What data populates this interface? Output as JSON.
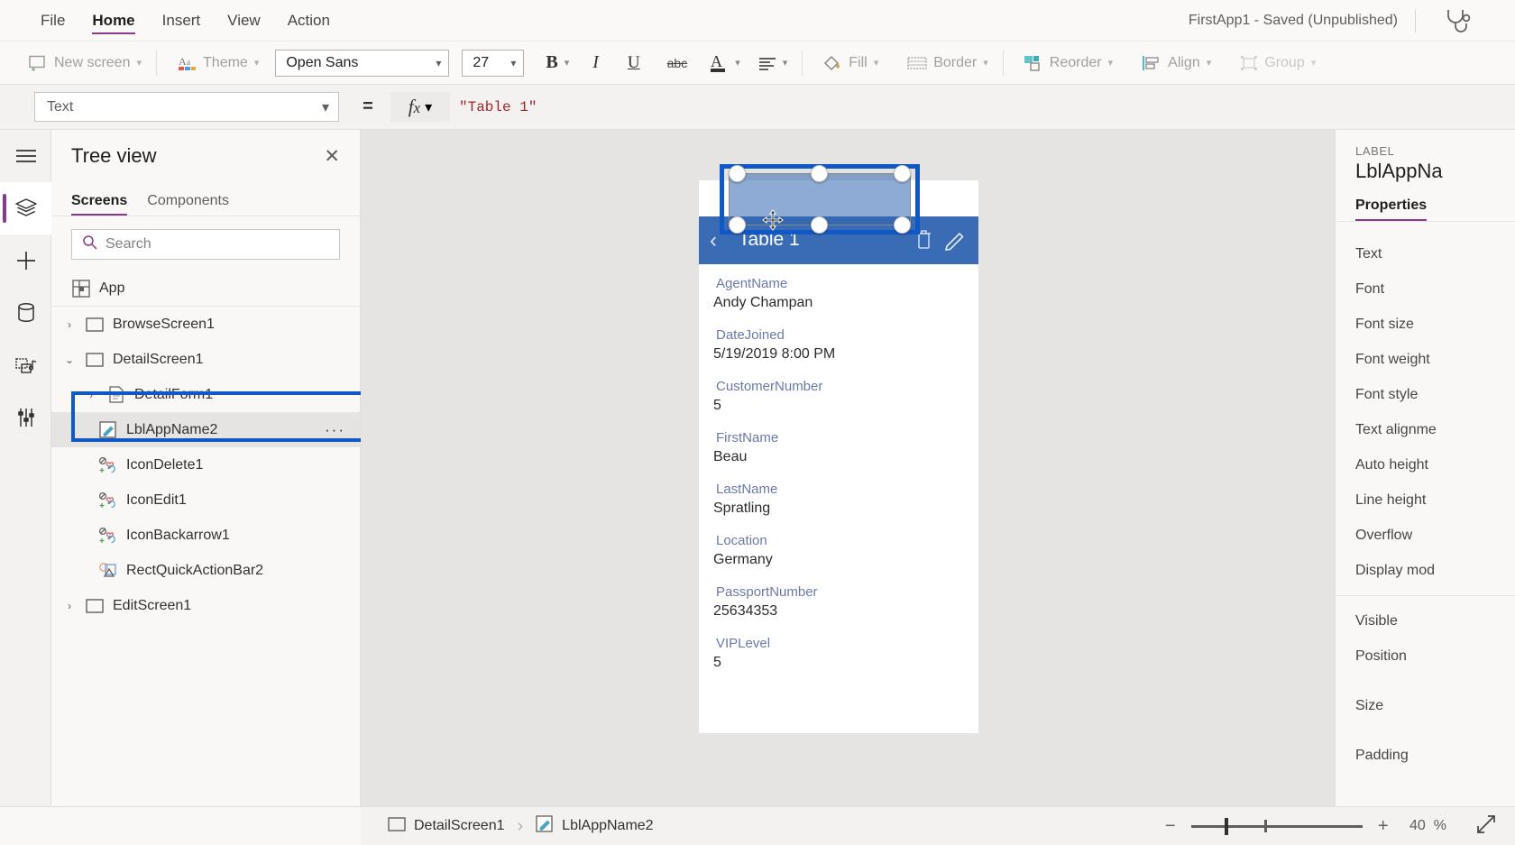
{
  "menubar": {
    "items": [
      {
        "label": "File",
        "active": false
      },
      {
        "label": "Home",
        "active": true
      },
      {
        "label": "Insert",
        "active": false
      },
      {
        "label": "View",
        "active": false
      },
      {
        "label": "Action",
        "active": false
      }
    ],
    "app_status": "FirstApp1 - Saved (Unpublished)",
    "checker_icon": "stethoscope-icon"
  },
  "ribbon": {
    "new_screen": "New screen",
    "theme": "Theme",
    "font_family": "Open Sans",
    "font_size": "27",
    "bold": "B",
    "italic": "I",
    "underline": "U",
    "strikethrough": "abc",
    "font_color": "A",
    "align": "align-icon",
    "fill": "Fill",
    "border": "Border",
    "reorder": "Reorder",
    "align_label": "Align",
    "group": "Group"
  },
  "formula_bar": {
    "property": "Text",
    "equals": "=",
    "fx": "fx",
    "value": "\"Table 1\""
  },
  "rail": {
    "items": [
      {
        "name": "hamburger-icon",
        "active": false
      },
      {
        "name": "tree-view-icon",
        "active": true
      },
      {
        "name": "insert-icon",
        "active": false
      },
      {
        "name": "data-icon",
        "active": false
      },
      {
        "name": "media-icon",
        "active": false
      },
      {
        "name": "variables-icon",
        "active": false
      }
    ]
  },
  "treeview": {
    "title": "Tree view",
    "close": "✕",
    "tabs": [
      {
        "label": "Screens",
        "active": true
      },
      {
        "label": "Components",
        "active": false
      }
    ],
    "search_placeholder": "Search",
    "search_value": "",
    "nodes": [
      {
        "label": "App",
        "icon": "app-icon",
        "caret": "",
        "indent": 0,
        "selected": false
      },
      {
        "label": "BrowseScreen1",
        "icon": "screen-icon",
        "caret": "›",
        "indent": 0,
        "selected": false
      },
      {
        "label": "DetailScreen1",
        "icon": "screen-icon",
        "caret": "⌄",
        "indent": 0,
        "selected": false
      },
      {
        "label": "DetailForm1",
        "icon": "form-icon",
        "caret": "›",
        "indent": 1,
        "selected": false
      },
      {
        "label": "LblAppName2",
        "icon": "label-icon",
        "caret": "",
        "indent": 1,
        "selected": true,
        "overflow": "···"
      },
      {
        "label": "IconDelete1",
        "icon": "icon-control-icon",
        "caret": "",
        "indent": 1,
        "selected": false
      },
      {
        "label": "IconEdit1",
        "icon": "icon-control-icon",
        "caret": "",
        "indent": 1,
        "selected": false
      },
      {
        "label": "IconBackarrow1",
        "icon": "icon-control-icon",
        "caret": "",
        "indent": 1,
        "selected": false
      },
      {
        "label": "RectQuickActionBar2",
        "icon": "shape-icon",
        "caret": "",
        "indent": 1,
        "selected": false
      },
      {
        "label": "EditScreen1",
        "icon": "screen-icon",
        "caret": "›",
        "indent": 0,
        "selected": false
      }
    ]
  },
  "canvas": {
    "quick_action_bar": {
      "back_icon": "back-arrow-icon",
      "title": "Table 1",
      "delete_icon": "trash-icon",
      "edit_icon": "pencil-icon",
      "bar_color": "#3a6bb5"
    },
    "selection": {
      "color": "#1158c7",
      "move_cursor": "move-cursor-icon"
    },
    "form_fields": [
      {
        "label": "AgentName",
        "value": "Andy Champan"
      },
      {
        "label": "DateJoined",
        "value": "5/19/2019 8:00 PM"
      },
      {
        "label": "CustomerNumber",
        "value": "5"
      },
      {
        "label": "FirstName",
        "value": "Beau"
      },
      {
        "label": "LastName",
        "value": "Spratling"
      },
      {
        "label": "Location",
        "value": "Germany"
      },
      {
        "label": "PassportNumber",
        "value": "25634353"
      },
      {
        "label": "VIPLevel",
        "value": "5"
      }
    ]
  },
  "right_panel": {
    "kind": "LABEL",
    "name": "LblAppNa",
    "tab": "Properties",
    "groups": [
      [
        "Text",
        "Font",
        "Font size",
        "Font weight",
        "Font style",
        "Text alignme",
        "Auto height",
        "Line height",
        "Overflow",
        "Display mod"
      ],
      [
        "Visible",
        "Position",
        "Size",
        "Padding"
      ]
    ]
  },
  "statusbar": {
    "breadcrumb": [
      {
        "label": "DetailScreen1",
        "icon": "screen-icon"
      },
      {
        "label": "LblAppName2",
        "icon": "label-icon"
      }
    ],
    "separator": "›",
    "zoom_out": "−",
    "zoom_in": "+",
    "zoom_value": "40",
    "zoom_unit": "%",
    "expand_icon": "expand-icon"
  }
}
